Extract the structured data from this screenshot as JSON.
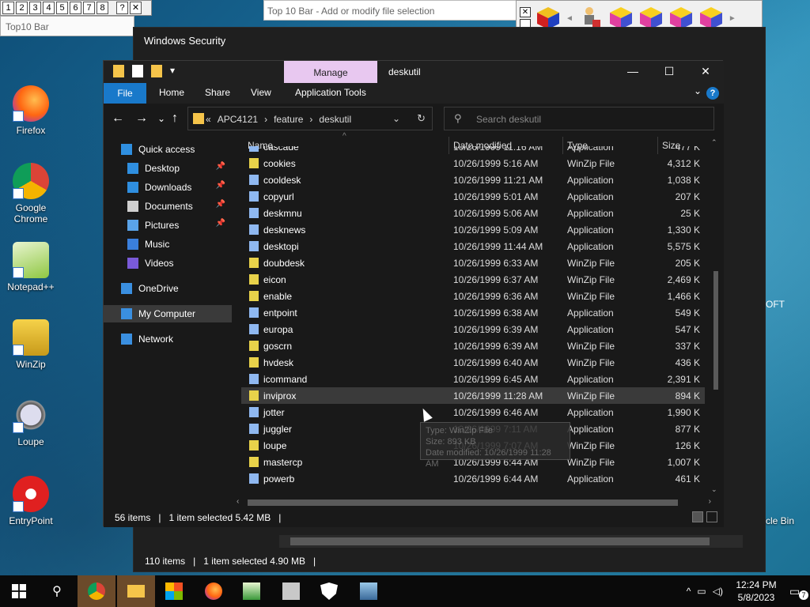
{
  "top10bar": {
    "numbers": [
      "1",
      "2",
      "3",
      "4",
      "5",
      "6",
      "7",
      "8"
    ],
    "help": "?",
    "close": "✕",
    "title": "Top10 Bar",
    "add_modify_title": "Top 10 Bar - Add or modify file selection",
    "ctl_x": "✕",
    "ctl_left": "◄",
    "ctl_right": "►"
  },
  "desktop": {
    "icons": [
      {
        "label": "Firefox"
      },
      {
        "label": "Google Chrome"
      },
      {
        "label": "Notepad++"
      },
      {
        "label": "WinZip"
      },
      {
        "label": "Loupe"
      },
      {
        "label": "EntryPoint"
      }
    ],
    "right_text": "OFT",
    "recycle": "ycle Bin"
  },
  "winsec": {
    "title": "Windows Security",
    "status_items": "110 items",
    "status_selected": "1 item selected  4.90 MB"
  },
  "explorer": {
    "manage_tab": "Manage",
    "title": "deskutil",
    "win_min": "—",
    "win_max": "☐",
    "win_close": "✕",
    "ribbon": {
      "file": "File",
      "home": "Home",
      "share": "Share",
      "view": "View",
      "app_tools": "Application Tools",
      "help": "?"
    },
    "nav": {
      "back": "←",
      "forward": "→",
      "recent": "⌄",
      "up": "↑"
    },
    "address": {
      "prefix": "«",
      "crumbs": [
        "APC4121",
        "›",
        "feature",
        "›",
        "deskutil"
      ],
      "dropdown": "⌄",
      "refresh": "↻"
    },
    "search": {
      "placeholder": "Search deskutil"
    },
    "navpane": [
      {
        "label": "Quick access",
        "color": "#2f8fe0",
        "pinned": false
      },
      {
        "label": "Desktop",
        "color": "#2f8fe0",
        "pinned": true
      },
      {
        "label": "Downloads",
        "color": "#2f8fe0",
        "pinned": true
      },
      {
        "label": "Documents",
        "color": "#d0d0d0",
        "pinned": true
      },
      {
        "label": "Pictures",
        "color": "#5aa3e8",
        "pinned": true
      },
      {
        "label": "Music",
        "color": "#3a7fdc",
        "pinned": false
      },
      {
        "label": "Videos",
        "color": "#7a5ad8",
        "pinned": false
      },
      {
        "label": "OneDrive",
        "color": "#3a8fe0",
        "pinned": false
      },
      {
        "label": "My Computer",
        "color": "#3a8fe0",
        "pinned": false
      },
      {
        "label": "Network",
        "color": "#3a8fe0",
        "pinned": false
      }
    ],
    "pin_glyph": "📌",
    "columns": {
      "name": "Name",
      "date": "Date modified",
      "type": "Type",
      "size": "Size"
    },
    "files": [
      {
        "name": "cascade",
        "date": "10/26/1999 11:16 AM",
        "type": "Application",
        "size": "477 K"
      },
      {
        "name": "cookies",
        "date": "10/26/1999 5:16 AM",
        "type": "WinZip File",
        "size": "4,312 K"
      },
      {
        "name": "cooldesk",
        "date": "10/26/1999 11:21 AM",
        "type": "Application",
        "size": "1,038 K"
      },
      {
        "name": "copyurl",
        "date": "10/26/1999 5:01 AM",
        "type": "Application",
        "size": "207 K"
      },
      {
        "name": "deskmnu",
        "date": "10/26/1999 5:06 AM",
        "type": "Application",
        "size": "25 K"
      },
      {
        "name": "desknews",
        "date": "10/26/1999 5:09 AM",
        "type": "Application",
        "size": "1,330 K"
      },
      {
        "name": "desktopi",
        "date": "10/26/1999 11:44 AM",
        "type": "Application",
        "size": "5,575 K"
      },
      {
        "name": "doubdesk",
        "date": "10/26/1999 6:33 AM",
        "type": "WinZip File",
        "size": "205 K"
      },
      {
        "name": "eicon",
        "date": "10/26/1999 6:37 AM",
        "type": "WinZip File",
        "size": "2,469 K"
      },
      {
        "name": "enable",
        "date": "10/26/1999 6:36 AM",
        "type": "WinZip File",
        "size": "1,466 K"
      },
      {
        "name": "entpoint",
        "date": "10/26/1999 6:38 AM",
        "type": "Application",
        "size": "549 K"
      },
      {
        "name": "europa",
        "date": "10/26/1999 6:39 AM",
        "type": "Application",
        "size": "547 K"
      },
      {
        "name": "goscrn",
        "date": "10/26/1999 6:39 AM",
        "type": "WinZip File",
        "size": "337 K"
      },
      {
        "name": "hvdesk",
        "date": "10/26/1999 6:40 AM",
        "type": "WinZip File",
        "size": "436 K"
      },
      {
        "name": "icommand",
        "date": "10/26/1999 6:45 AM",
        "type": "Application",
        "size": "2,391 K"
      },
      {
        "name": "inviprox",
        "date": "10/26/1999 11:28 AM",
        "type": "WinZip File",
        "size": "894 K"
      },
      {
        "name": "jotter",
        "date": "10/26/1999 6:46 AM",
        "type": "Application",
        "size": "1,990 K"
      },
      {
        "name": "juggler",
        "date": "10/26/1999 7:11 AM",
        "type": "Application",
        "size": "877 K"
      },
      {
        "name": "loupe",
        "date": "10/26/1999 7:07 AM",
        "type": "WinZip File",
        "size": "126 K"
      },
      {
        "name": "mastercp",
        "date": "10/26/1999 6:44 AM",
        "type": "WinZip File",
        "size": "1,007 K"
      },
      {
        "name": "powerb",
        "date": "10/26/1999 6:44 AM",
        "type": "Application",
        "size": "461 K"
      }
    ],
    "selected_index": 15,
    "tooltip": {
      "type": "Type: WinZip File",
      "size": "Size: 893 KB",
      "date": "Date modified: 10/26/1999 11:28 AM"
    },
    "status": {
      "items": "56 items",
      "selected": "1 item selected  5.42 MB"
    }
  },
  "taskbar": {
    "clock_time": "12:24 PM",
    "clock_date": "5/8/2023",
    "notif_count": "7"
  },
  "colors": {
    "accent": "#1979ca",
    "manage": "#e8c8f0",
    "folder": "#f5c44a",
    "selected_row": "#3a3a3a"
  }
}
